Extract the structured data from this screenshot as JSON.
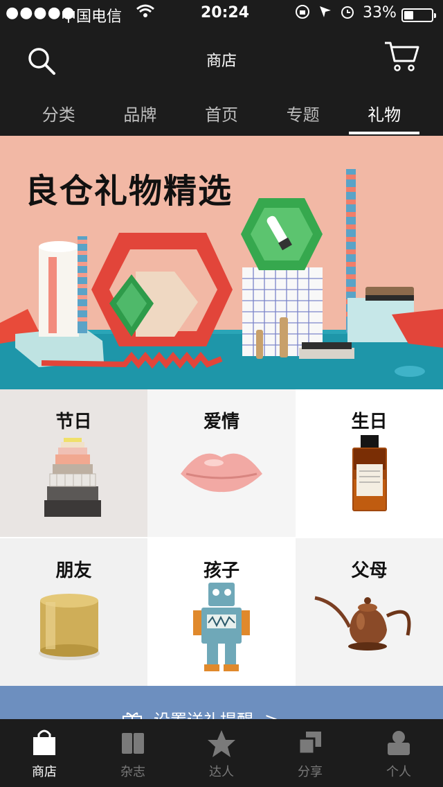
{
  "status_bar": {
    "signal": "●●●●●",
    "carrier": "中国电信",
    "time": "20:24",
    "battery_percent": "33%",
    "battery_level": 0.33
  },
  "nav": {
    "title": "商店",
    "search_icon": "search-icon",
    "cart_icon": "cart-icon"
  },
  "tabs": [
    {
      "label": "分类",
      "active": false
    },
    {
      "label": "品牌",
      "active": false
    },
    {
      "label": "首页",
      "active": false
    },
    {
      "label": "专题",
      "active": false
    },
    {
      "label": "礼物",
      "active": true
    }
  ],
  "banner": {
    "title": "良仓礼物精选"
  },
  "categories": [
    {
      "label": "节日",
      "image": "stacked-boxes"
    },
    {
      "label": "爱情",
      "image": "lips-box"
    },
    {
      "label": "生日",
      "image": "perfume-bottle"
    },
    {
      "label": "朋友",
      "image": "gold-candle"
    },
    {
      "label": "孩子",
      "image": "robot-toy"
    },
    {
      "label": "父母",
      "image": "copper-kettle"
    }
  ],
  "reminder": {
    "label": "设置送礼提醒",
    "arrow": ">",
    "icon": "gift-icon"
  },
  "tabbar": [
    {
      "label": "商店",
      "icon": "bag-icon",
      "active": true
    },
    {
      "label": "杂志",
      "icon": "book-icon",
      "active": false
    },
    {
      "label": "达人",
      "icon": "star-icon",
      "active": false
    },
    {
      "label": "分享",
      "icon": "share-icon",
      "active": false
    },
    {
      "label": "个人",
      "icon": "person-icon",
      "active": false
    }
  ],
  "colors": {
    "bar_bg": "#1c1c1c",
    "banner_bg": "#f2b8a5",
    "reminder_bg": "#6d8fbf",
    "inactive_text": "#7a7a7a"
  }
}
